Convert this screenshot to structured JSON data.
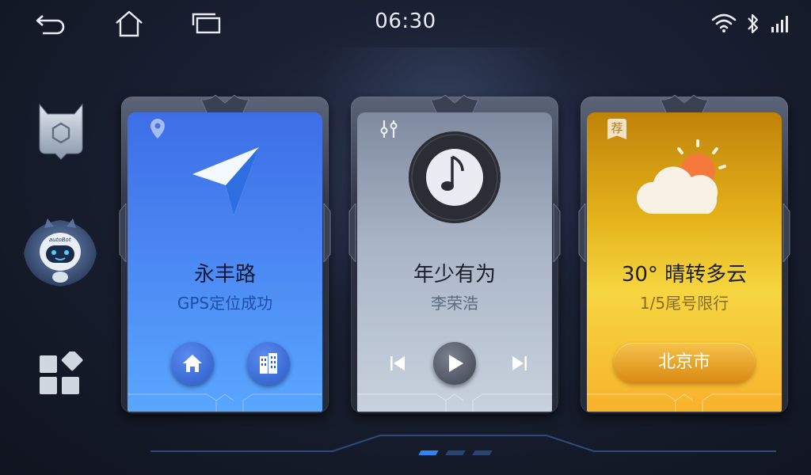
{
  "status_bar": {
    "time": "06:30",
    "icons": [
      "back-icon",
      "home-icon",
      "recent-apps-icon",
      "wifi-icon",
      "bluetooth-icon",
      "signal-icon"
    ]
  },
  "sidebar": {
    "items": [
      {
        "name": "hexagon-app",
        "icon": "hexagon-icon"
      },
      {
        "name": "robot-assistant",
        "icon": "robot-icon",
        "logo_text": "autoBot"
      },
      {
        "name": "app-grid",
        "icon": "grid-icon"
      }
    ]
  },
  "cards": {
    "navigation": {
      "title": "永丰路",
      "subtitle": "GPS定位成功",
      "badge_icon": "location-pin-icon",
      "buttons": [
        "home-icon",
        "office-building-icon"
      ],
      "accent": "#3f8cff"
    },
    "music": {
      "title": "年少有为",
      "subtitle": "李荣浩",
      "badge_icon": "equalizer-icon",
      "controls": [
        "previous-icon",
        "play-icon",
        "next-icon"
      ],
      "accent": "#aeb9c9"
    },
    "weather": {
      "title": "30° 晴转多云",
      "subtitle": "1/5尾号限行",
      "badge": "荐",
      "city_button": "北京市",
      "accent": "#f3b327"
    }
  },
  "pager": {
    "count": 3,
    "active": 0
  }
}
